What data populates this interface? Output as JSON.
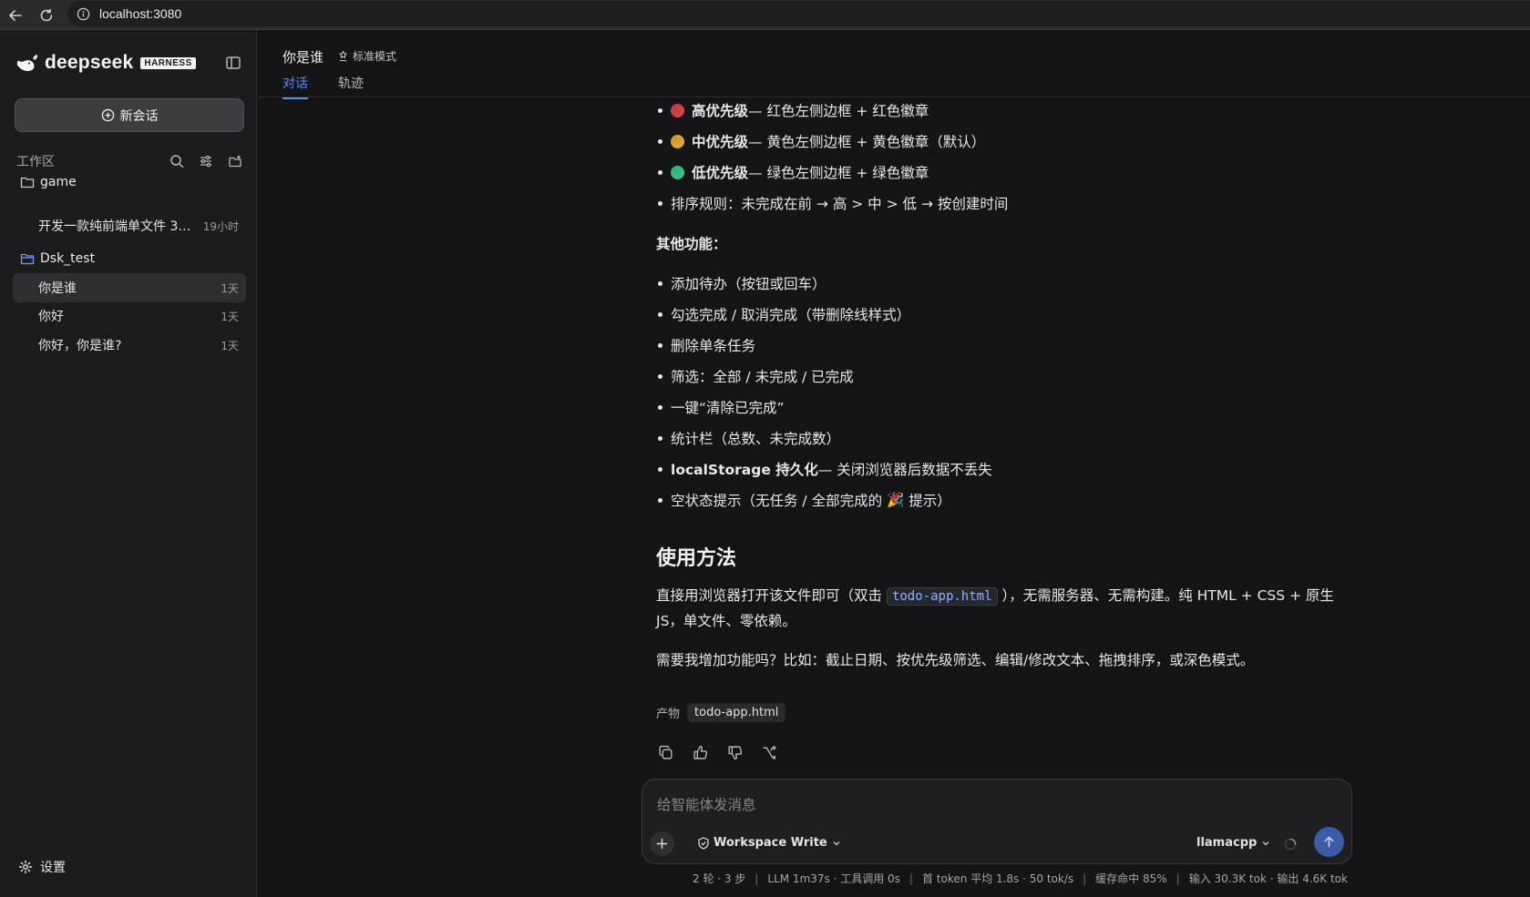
{
  "browser": {
    "url": "localhost:3080"
  },
  "sidebar": {
    "brand": "deepseek",
    "badge": "HARNESS",
    "new_chat_label": "新会话",
    "workspace_label": "工作区",
    "groups": [
      {
        "name": "game",
        "sessions": [
          {
            "title": "开发一款纯前端单文件 3D ...",
            "time": "19小时"
          }
        ]
      },
      {
        "name": "Dsk_test",
        "sessions": [
          {
            "title": "你是谁",
            "time": "1天"
          },
          {
            "title": "你好",
            "time": "1天"
          },
          {
            "title": "你好，你是谁?",
            "time": "1天"
          }
        ]
      }
    ],
    "settings_label": "设置"
  },
  "header": {
    "title": "你是谁",
    "mode_label": "标准模式",
    "tabs": [
      {
        "label": "对话",
        "active": true
      },
      {
        "label": "轨迹",
        "active": false
      }
    ]
  },
  "message": {
    "priority_items": [
      {
        "label": "高优先级",
        "desc": " — 红色左侧边框 + 红色徽章",
        "color": "#e5484d"
      },
      {
        "label": "中优先级",
        "desc": " — 黄色左侧边框 + 黄色徽章（默认）",
        "color": "#f2b53a"
      },
      {
        "label": "低优先级",
        "desc": " — 绿色左侧边框 + 绿色徽章",
        "color": "#3ecf8e"
      }
    ],
    "sort_rule": "排序规则：未完成在前 → 高 > 中 > 低 → 按创建时间",
    "other_title": "其他功能",
    "other_items": [
      "添加待办（按钮或回车）",
      "勾选完成 / 取消完成（带删除线样式）",
      "删除单条任务",
      "筛选：全部 / 未完成 / 已完成",
      "一键“清除已完成”",
      "统计栏（总数、未完成数）"
    ],
    "storage_item": {
      "bold": "localStorage 持久化",
      "rest": " — 关闭浏览器后数据不丢失"
    },
    "empty_item": {
      "before": "空状态提示（无任务 / 全部完成的 ",
      "emoji": "🎉",
      "after": " 提示）"
    },
    "usage_title": "使用方法",
    "usage_before": "直接用浏览器打开该文件即可（双击 ",
    "usage_code": "todo-app.html",
    "usage_after": " ），无需服务器、无需构建。纯 HTML + CSS + 原生 JS，单文件、零依赖。",
    "followup": "需要我增加功能吗？比如：截止日期、按优先级筛选、编辑/修改文本、拖拽排序，或深色模式。",
    "artifact_label": "产物",
    "artifact_file": "todo-app.html"
  },
  "composer": {
    "placeholder": "给智能体发消息",
    "permission": "Workspace Write",
    "model": "llamacpp"
  },
  "stats": [
    "2 轮 · 3 步",
    "LLM 1m37s · 工具调用 0s",
    "首 token 平均 1.8s · 50 tok/s",
    "缓存命中 85%",
    "输入 30.3K tok · 输出 4.6K tok"
  ]
}
